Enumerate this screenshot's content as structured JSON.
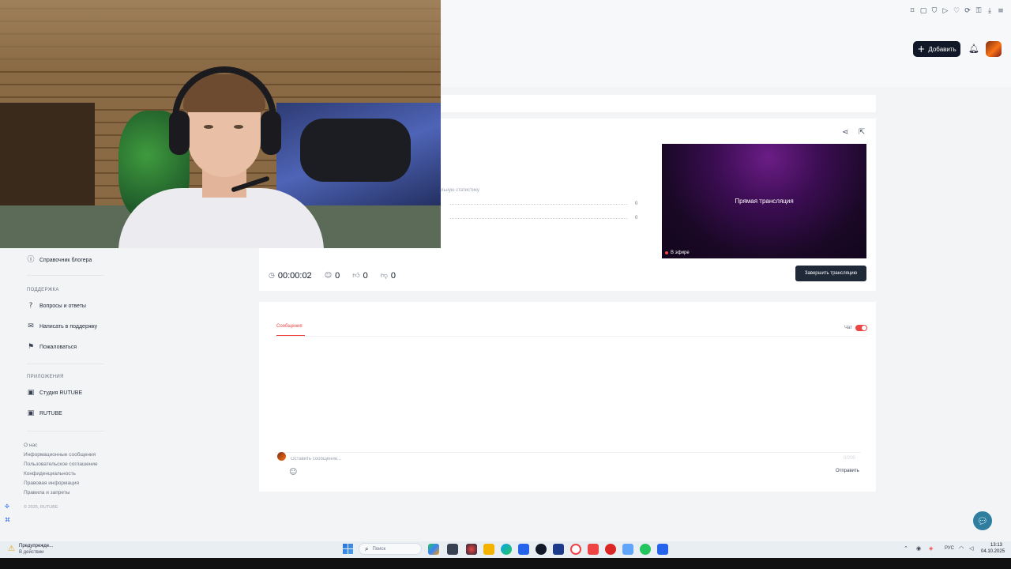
{
  "header": {
    "add_button_label": "Добавить",
    "ext_icons": [
      "bookmark-icon",
      "reader-icon",
      "shield-icon",
      "play-icon",
      "heart-icon",
      "sync-icon",
      "lock-icon",
      "download-icon",
      "menu-icon"
    ]
  },
  "sidebar": {
    "top_item": "Справочник блогера",
    "support_heading": "ПОДДЕРЖКА",
    "support_items": [
      "Вопросы и ответы",
      "Написать в поддержку",
      "Пожаловаться"
    ],
    "apps_heading": "ПРИЛОЖЕНИЯ",
    "apps_items": [
      "Студия RUTUBE",
      "RUTUBE"
    ],
    "footer_links": [
      "О нас",
      "Информационные сообщения",
      "Пользовательское соглашение",
      "Конфиденциальность",
      "Правовая информация",
      "Правила и запреты"
    ],
    "copyright": "© 2025, RUTUBE"
  },
  "stream": {
    "stats_partial": "льную статистику",
    "stat_rows": [
      "0",
      "0"
    ],
    "player_title": "Прямая трансляция",
    "live_badge": "В эфире",
    "duration": "00:00:02",
    "viewers": "0",
    "likes": "0",
    "dislikes": "0",
    "end_button_label": "Завершить трансляцию"
  },
  "chat": {
    "tab_messages": "Сообщения",
    "chat_toggle_label": "Чат",
    "chat_enabled": true,
    "input_placeholder": "Оставить сообщение...",
    "char_count": "0/200",
    "send_label": "Отправить"
  },
  "taskbar": {
    "weather_title": "Предупрежде...",
    "weather_sub": "В действии",
    "search_placeholder": "Поиск",
    "lang": "РУС",
    "time": "13:13",
    "date": "04.10.2025"
  },
  "colors": {
    "accent": "#ef4444",
    "dark_button": "#1f2937",
    "player_purple": "#3b0d52",
    "help_fab": "#2f7ea0"
  }
}
